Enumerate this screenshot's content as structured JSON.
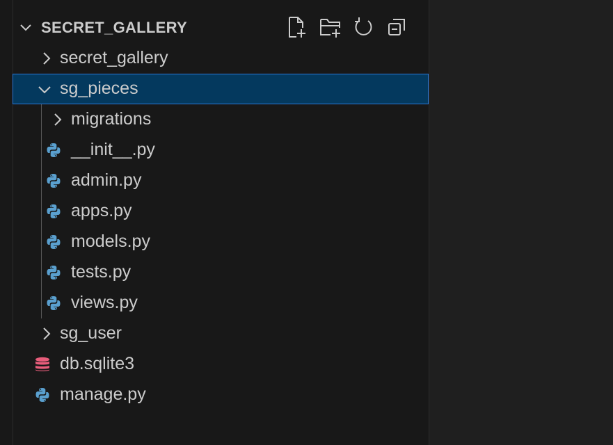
{
  "explorer": {
    "section_title": "SECRET_GALLERY",
    "actions": [
      {
        "name": "new-file-icon"
      },
      {
        "name": "new-folder-icon"
      },
      {
        "name": "refresh-icon"
      },
      {
        "name": "collapse-all-icon"
      }
    ],
    "colors": {
      "background": "#181818",
      "selection": "#04395e",
      "selection_border": "#2b79d8",
      "python_icon": "#5aa0cf",
      "db_icon": "#e85d7b",
      "text": "#cccccc"
    },
    "tree": [
      {
        "label": "secret_gallery",
        "kind": "folder",
        "expanded": false,
        "depth": 1
      },
      {
        "label": "sg_pieces",
        "kind": "folder",
        "expanded": true,
        "depth": 1,
        "selected": true
      },
      {
        "label": "migrations",
        "kind": "folder",
        "expanded": false,
        "depth": 2
      },
      {
        "label": "__init__.py",
        "kind": "python",
        "depth": 2
      },
      {
        "label": "admin.py",
        "kind": "python",
        "depth": 2
      },
      {
        "label": "apps.py",
        "kind": "python",
        "depth": 2
      },
      {
        "label": "models.py",
        "kind": "python",
        "depth": 2
      },
      {
        "label": "tests.py",
        "kind": "python",
        "depth": 2
      },
      {
        "label": "views.py",
        "kind": "python",
        "depth": 2
      },
      {
        "label": "sg_user",
        "kind": "folder",
        "expanded": false,
        "depth": 1
      },
      {
        "label": "db.sqlite3",
        "kind": "database",
        "depth": 1
      },
      {
        "label": "manage.py",
        "kind": "python",
        "depth": 1
      }
    ]
  }
}
